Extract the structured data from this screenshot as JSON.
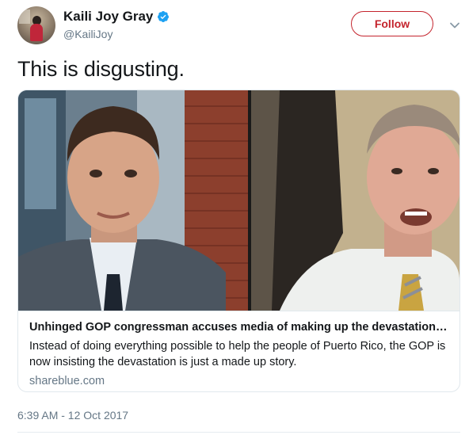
{
  "author": {
    "display_name": "Kaili Joy Gray",
    "handle": "@KailiJoy",
    "verified_icon": "verified-badge-icon"
  },
  "follow_label": "Follow",
  "tweet": {
    "text": "This is disgusting."
  },
  "card": {
    "title": "Unhinged GOP congressman accuses media of making up the devastation of...",
    "description": "Instead of doing everything possible to help the people of Puerto Rico, the GOP is now insisting the devastation is just a made up story.",
    "domain": "shareblue.com"
  },
  "timestamp": "6:39 AM - 12 Oct 2017",
  "colors": {
    "follow_accent": "#c4242d",
    "verified_blue": "#1da1f2",
    "secondary_text": "#657786"
  }
}
